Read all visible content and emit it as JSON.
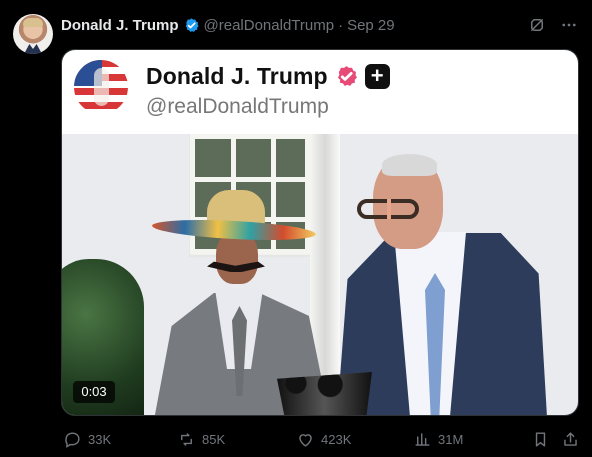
{
  "tweet": {
    "author_name": "Donald J. Trump",
    "handle": "@realDonaldTrump",
    "separator": "·",
    "date": "Sep 29"
  },
  "quoted_card": {
    "name": "Donald J. Trump",
    "handle": "@realDonaldTrump",
    "plus_badge": "+"
  },
  "media": {
    "duration": "0:03"
  },
  "actions": {
    "replies": "33K",
    "reposts": "85K",
    "likes": "423K",
    "views": "31M"
  },
  "icons": [
    "verified-icon",
    "grok-icon",
    "more-icon",
    "reply-icon",
    "repost-icon",
    "like-icon",
    "views-icon",
    "bookmark-icon",
    "share-icon"
  ],
  "colors": {
    "background": "#000000",
    "secondary_text": "#71767b",
    "verified_blue": "#1d9bf0",
    "pink_badge": "#e84a78"
  }
}
